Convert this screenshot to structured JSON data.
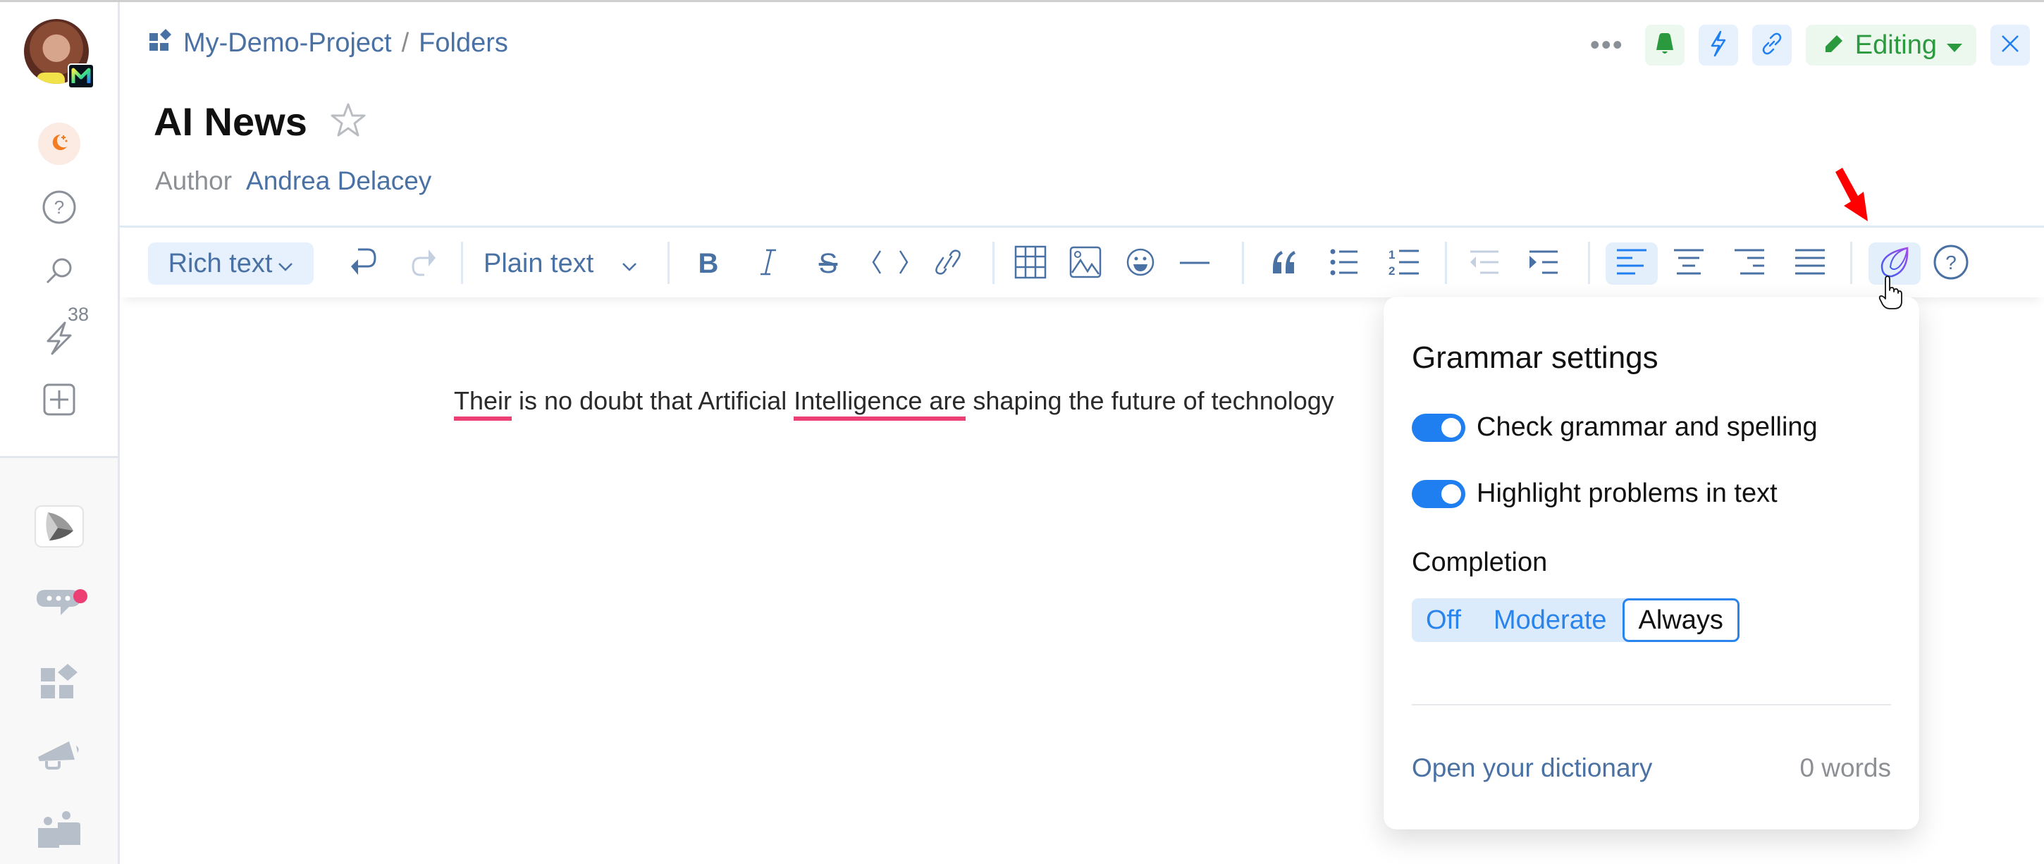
{
  "sidebar": {
    "user_badge": "M",
    "items": [
      {
        "name": "theme",
        "icon": "moon-icon"
      },
      {
        "name": "help",
        "icon": "help-icon"
      },
      {
        "name": "search",
        "icon": "search-icon"
      },
      {
        "name": "activity",
        "icon": "lightning-icon",
        "count": "38"
      },
      {
        "name": "create",
        "icon": "plus-square-icon"
      }
    ],
    "apps": [
      {
        "name": "app-launcher",
        "icon": "app-logo-icon"
      },
      {
        "name": "chat",
        "icon": "chat-icon",
        "has_notification": true
      },
      {
        "name": "projects",
        "icon": "blocks-icon"
      },
      {
        "name": "announcements",
        "icon": "megaphone-icon"
      },
      {
        "name": "teams",
        "icon": "team-icon"
      }
    ]
  },
  "header": {
    "breadcrumb": [
      "My-Demo-Project",
      "Folders"
    ],
    "breadcrumb_separator": "/",
    "more_label": "•••",
    "mode_button": "Editing",
    "title": "AI News",
    "author_label": "Author",
    "author_name": "Andrea Delacey"
  },
  "toolbar": {
    "format_select": "Rich text",
    "block_style_select": "Plain text",
    "buttons": [
      "undo",
      "redo",
      "bold",
      "italic",
      "strikethrough",
      "code",
      "link",
      "table",
      "image",
      "emoji",
      "horizontal-rule",
      "quote",
      "bullet-list",
      "numbered-list",
      "outdent",
      "indent",
      "align-left",
      "align-center",
      "align-right",
      "justify",
      "grammar",
      "help"
    ],
    "active_alignment": "align-left",
    "active_tool": "grammar"
  },
  "editor": {
    "segments": [
      {
        "text": "Their",
        "error": true
      },
      {
        "text": " is no doubt that Artificial ",
        "error": false
      },
      {
        "text": "Intelligence are",
        "error": true
      },
      {
        "text": " shaping the future of technology",
        "error": false
      }
    ]
  },
  "grammar_popup": {
    "title": "Grammar settings",
    "toggles": [
      {
        "label": "Check grammar and spelling",
        "on": true
      },
      {
        "label": "Highlight problems in text",
        "on": true
      }
    ],
    "completion_label": "Completion",
    "completion_options": [
      "Off",
      "Moderate",
      "Always"
    ],
    "completion_selected": "Always",
    "dictionary_link": "Open your dictionary",
    "dictionary_count": "0 words"
  },
  "colors": {
    "accent_blue": "#1f7ff0",
    "link_blue": "#4a71a3",
    "editing_green": "#2b9a3e",
    "error_underline": "#ec3f74",
    "annotation_arrow": "#ff0000"
  }
}
